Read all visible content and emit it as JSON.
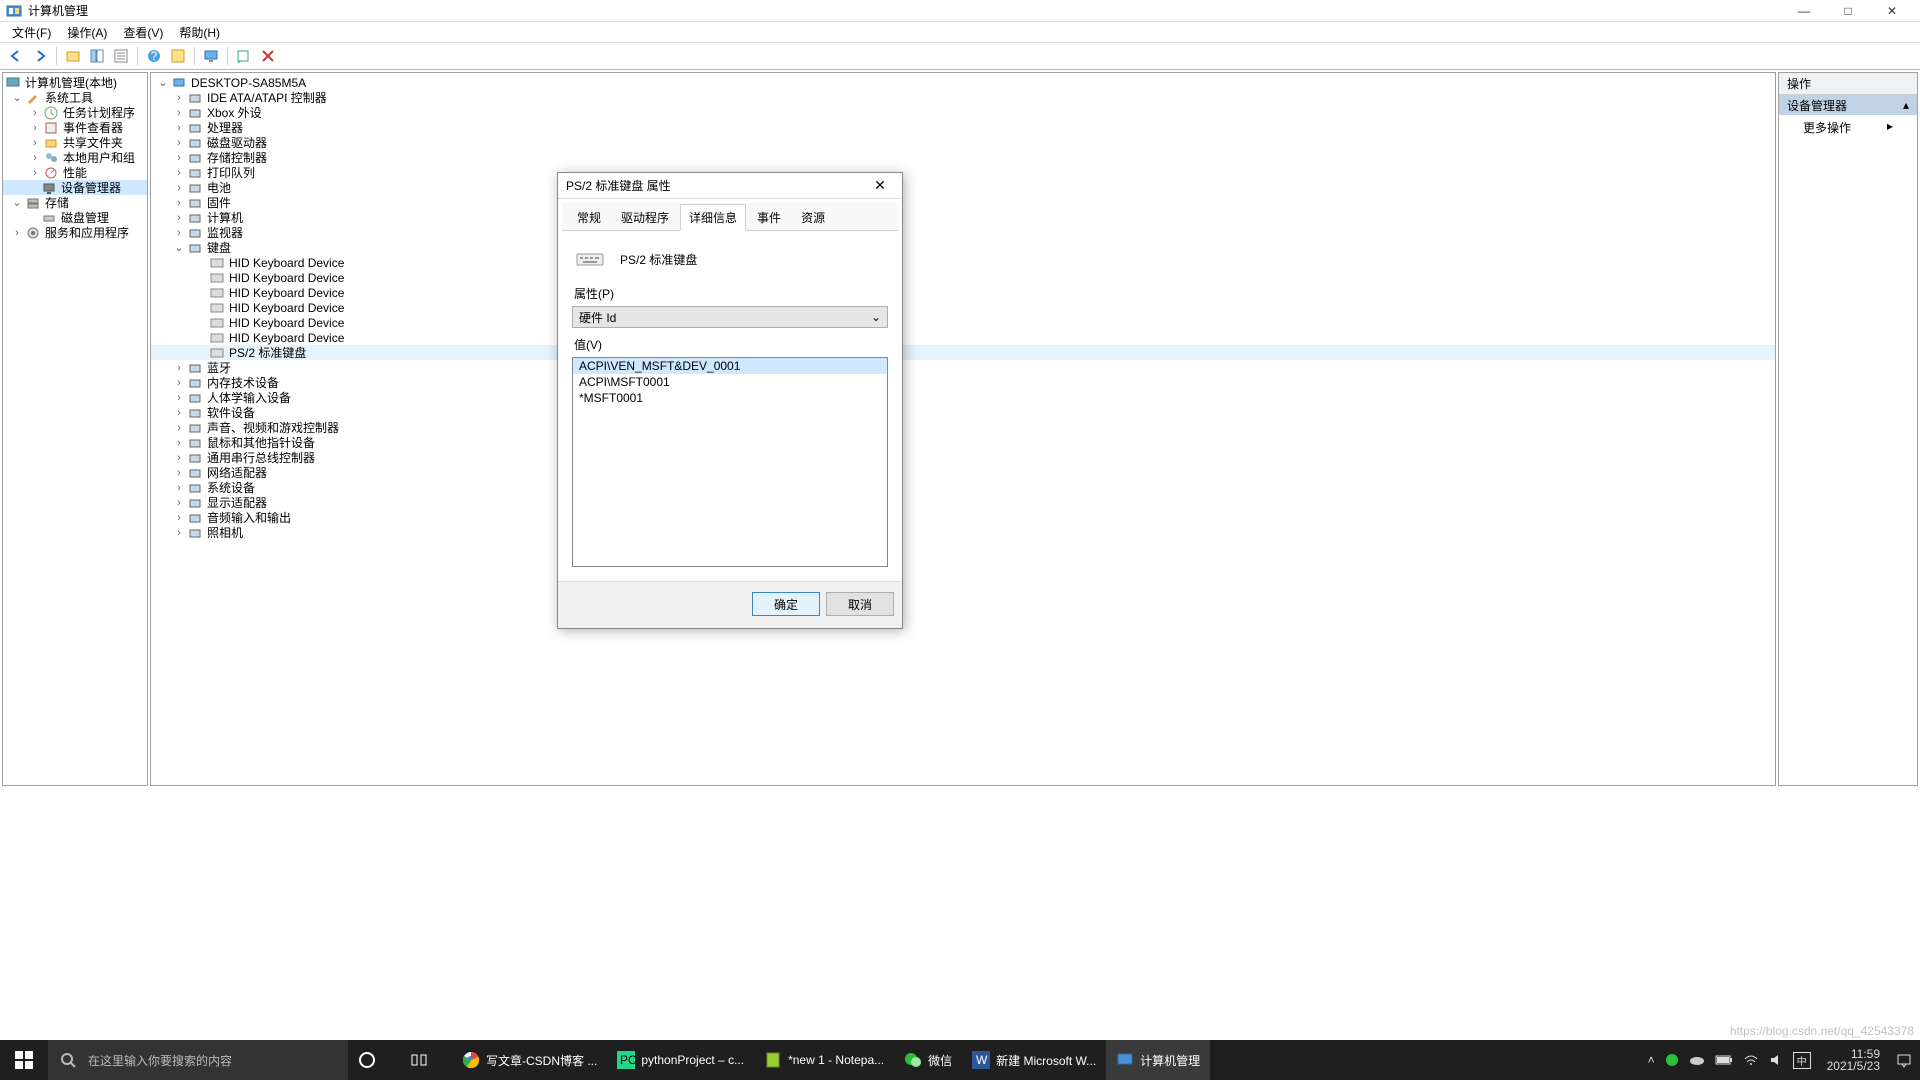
{
  "window": {
    "title": "计算机管理",
    "controls": {
      "min": "—",
      "max": "□",
      "close": "✕"
    }
  },
  "menu": [
    "文件(F)",
    "操作(A)",
    "查看(V)",
    "帮助(H)"
  ],
  "left_tree": {
    "root": "计算机管理(本地)",
    "system_tools": {
      "label": "系统工具",
      "children": [
        "任务计划程序",
        "事件查看器",
        "共享文件夹",
        "本地用户和组",
        "性能",
        "设备管理器"
      ]
    },
    "storage": {
      "label": "存储",
      "children": [
        "磁盘管理"
      ]
    },
    "services": "服务和应用程序"
  },
  "center_tree": {
    "root": "DESKTOP-SA85M5A",
    "nodes": [
      "IDE ATA/ATAPI 控制器",
      "Xbox 外设",
      "处理器",
      "磁盘驱动器",
      "存储控制器",
      "打印队列",
      "电池",
      "固件",
      "计算机",
      "监视器"
    ],
    "keyboard": {
      "label": "键盘",
      "children": [
        "HID Keyboard Device",
        "HID Keyboard Device",
        "HID Keyboard Device",
        "HID Keyboard Device",
        "HID Keyboard Device",
        "HID Keyboard Device",
        "PS/2 标准键盘"
      ]
    },
    "nodes2": [
      "蓝牙",
      "内存技术设备",
      "人体学输入设备",
      "软件设备",
      "声音、视频和游戏控制器",
      "鼠标和其他指针设备",
      "通用串行总线控制器",
      "网络适配器",
      "系统设备",
      "显示适配器",
      "音频输入和输出",
      "照相机"
    ]
  },
  "actions": {
    "header": "操作",
    "sub": "设备管理器",
    "more": "更多操作"
  },
  "dialog": {
    "title": "PS/2 标准键盘 属性",
    "tabs": [
      "常规",
      "驱动程序",
      "详细信息",
      "事件",
      "资源"
    ],
    "active_tab": "详细信息",
    "device_name": "PS/2 标准键盘",
    "prop_label": "属性(P)",
    "prop_value": "硬件 Id",
    "value_label": "值(V)",
    "values": [
      "ACPI\\VEN_MSFT&DEV_0001",
      "ACPI\\MSFT0001",
      "*MSFT0001"
    ],
    "ok": "确定",
    "cancel": "取消"
  },
  "taskbar": {
    "search_placeholder": "在这里输入你要搜索的内容",
    "apps": [
      {
        "label": "写文章-CSDN博客 ...",
        "icon": "chrome"
      },
      {
        "label": "pythonProject – c...",
        "icon": "pycharm"
      },
      {
        "label": "*new 1 - Notepa...",
        "icon": "notepad"
      },
      {
        "label": "微信",
        "icon": "wechat"
      },
      {
        "label": "新建 Microsoft W...",
        "icon": "word"
      },
      {
        "label": "计算机管理",
        "icon": "mmc"
      }
    ],
    "time": "11:59",
    "date": "2021/5/23"
  },
  "watermark": "https://blog.csdn.net/qq_42543378"
}
